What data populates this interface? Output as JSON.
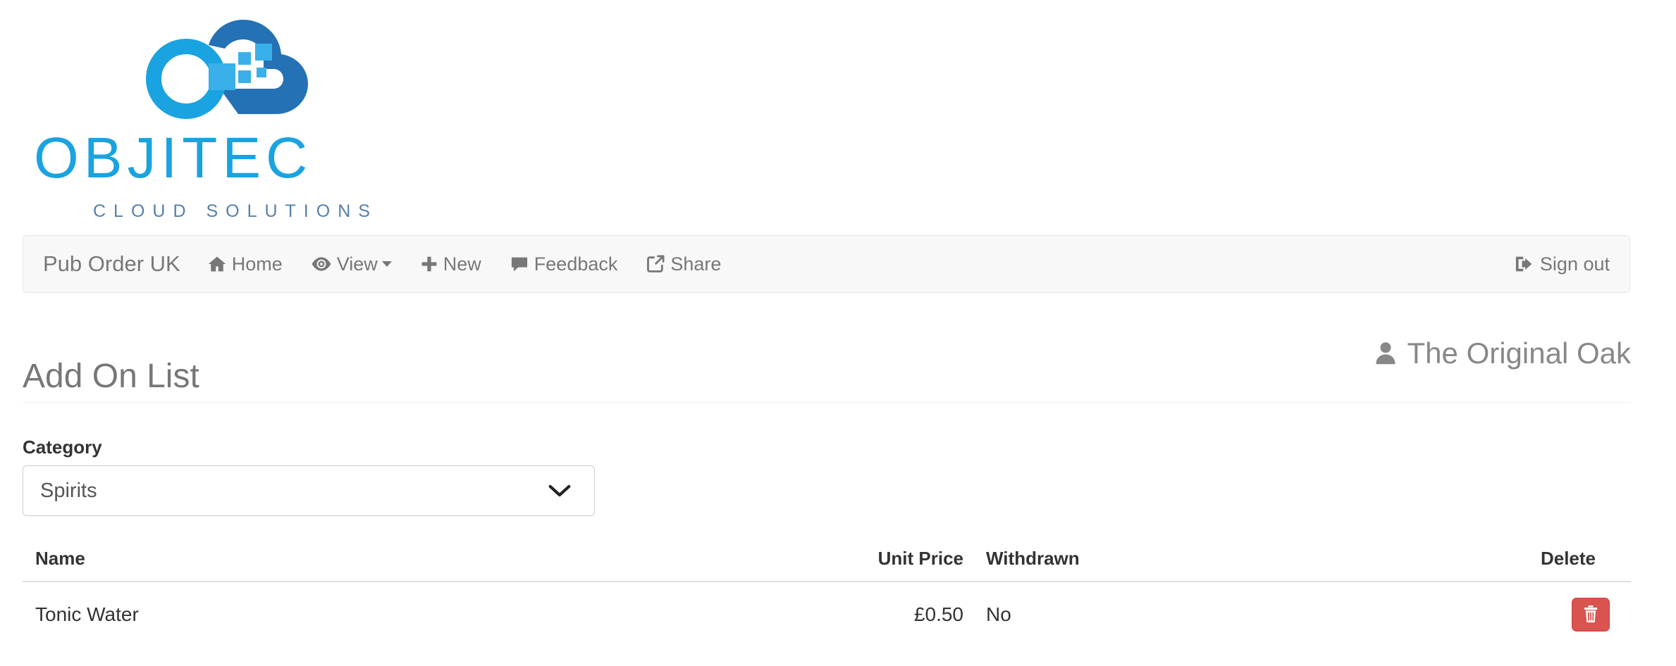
{
  "logo": {
    "wordmark": "OBJITEC",
    "tagline": "CLOUD SOLUTIONS",
    "primary_color": "#19a3e0",
    "secondary_color": "#2471b5",
    "tagline_color": "#5580ab"
  },
  "navbar": {
    "brand": "Pub Order UK",
    "items": [
      {
        "label": "Home",
        "icon": "home-icon",
        "has_caret": false
      },
      {
        "label": "View",
        "icon": "eye-icon",
        "has_caret": true
      },
      {
        "label": "New",
        "icon": "plus-icon",
        "has_caret": false
      },
      {
        "label": "Feedback",
        "icon": "comment-icon",
        "has_caret": false
      },
      {
        "label": "Share",
        "icon": "share-icon",
        "has_caret": false
      }
    ],
    "signout": {
      "label": "Sign out",
      "icon": "sign-out-icon"
    },
    "background_color": "#f8f8f8",
    "text_color": "#777777"
  },
  "page": {
    "title": "Add On List",
    "account": {
      "name": "The Original Oak",
      "icon": "user-icon"
    }
  },
  "form": {
    "category": {
      "label": "Category",
      "selected": "Spirits",
      "options": [
        "Spirits"
      ]
    }
  },
  "table": {
    "columns": [
      "Name",
      "Unit Price",
      "Withdrawn",
      "Delete"
    ],
    "rows": [
      {
        "name": "Tonic Water",
        "unit_price": "£0.50",
        "withdrawn": "No",
        "delete_icon": "trash-icon"
      }
    ],
    "delete_button_color": "#d9534f"
  }
}
